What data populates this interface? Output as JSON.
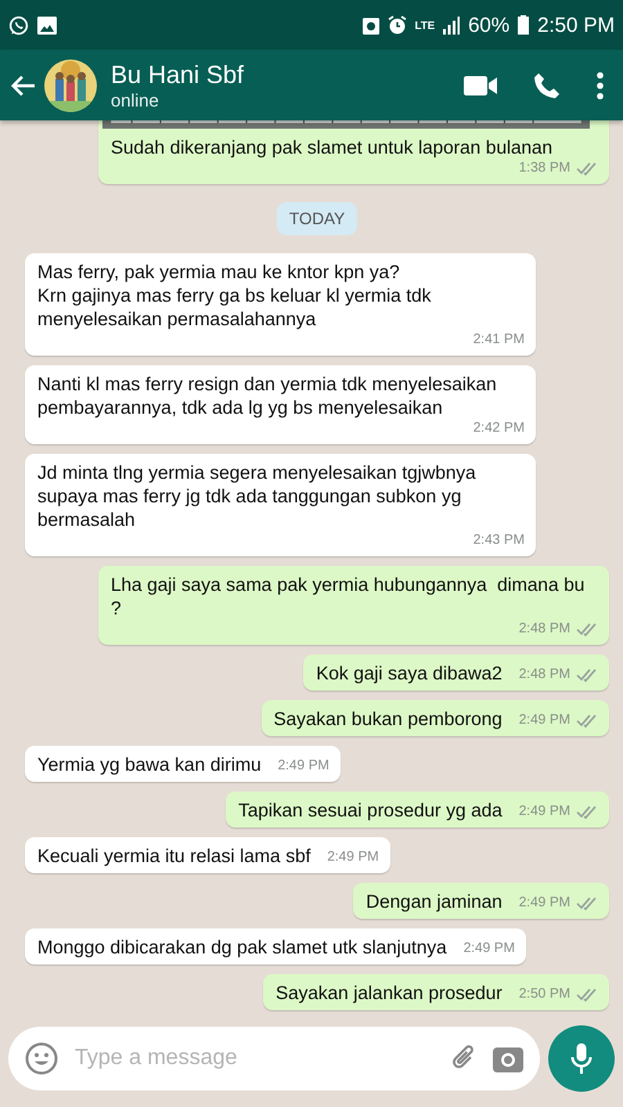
{
  "status_bar": {
    "network": "LTE",
    "battery": "60%",
    "time": "2:50 PM"
  },
  "header": {
    "name": "Bu Hani Sbf",
    "status": "online"
  },
  "messages": [
    {
      "kind": "out",
      "has_picture": true,
      "text": "Sudah dikeranjang pak slamet untuk laporan bulanan",
      "time": "1:38 PM"
    },
    {
      "kind": "date",
      "text": "TODAY"
    },
    {
      "kind": "in",
      "text": "Mas ferry, pak yermia mau ke kntor kpn ya?\nKrn gajinya mas ferry ga bs keluar kl yermia tdk menyelesaikan permasalahannya",
      "time": "2:41 PM"
    },
    {
      "kind": "in",
      "text": "Nanti kl mas ferry resign dan yermia tdk menyelesaikan pembayarannya, tdk ada lg yg bs menyelesaikan",
      "time": "2:42 PM"
    },
    {
      "kind": "in",
      "text": "Jd minta tlng yermia segera menyelesaikan tgjwbnya supaya mas ferry jg tdk ada tanggungan subkon yg bermasalah",
      "time": "2:43 PM"
    },
    {
      "kind": "out",
      "text": "Lha gaji saya sama pak yermia hubungannya  dimana bu ?",
      "time": "2:48 PM"
    },
    {
      "kind": "out",
      "text": "Kok gaji saya dibawa2",
      "time": "2:48 PM"
    },
    {
      "kind": "out",
      "text": "Sayakan bukan pemborong",
      "time": "2:49 PM"
    },
    {
      "kind": "in",
      "text": "Yermia yg bawa kan dirimu",
      "time": "2:49 PM"
    },
    {
      "kind": "out",
      "text": "Tapikan sesuai prosedur yg ada",
      "time": "2:49 PM"
    },
    {
      "kind": "in",
      "text": "Kecuali yermia itu relasi lama sbf",
      "time": "2:49 PM"
    },
    {
      "kind": "out",
      "text": "Dengan jaminan",
      "time": "2:49 PM"
    },
    {
      "kind": "in",
      "text": "Monggo dibicarakan dg pak slamet utk slanjutnya",
      "time": "2:49 PM"
    },
    {
      "kind": "out",
      "text": "Sayakan jalankan prosedur",
      "time": "2:50 PM"
    }
  ],
  "composer": {
    "placeholder": "Type a message"
  }
}
